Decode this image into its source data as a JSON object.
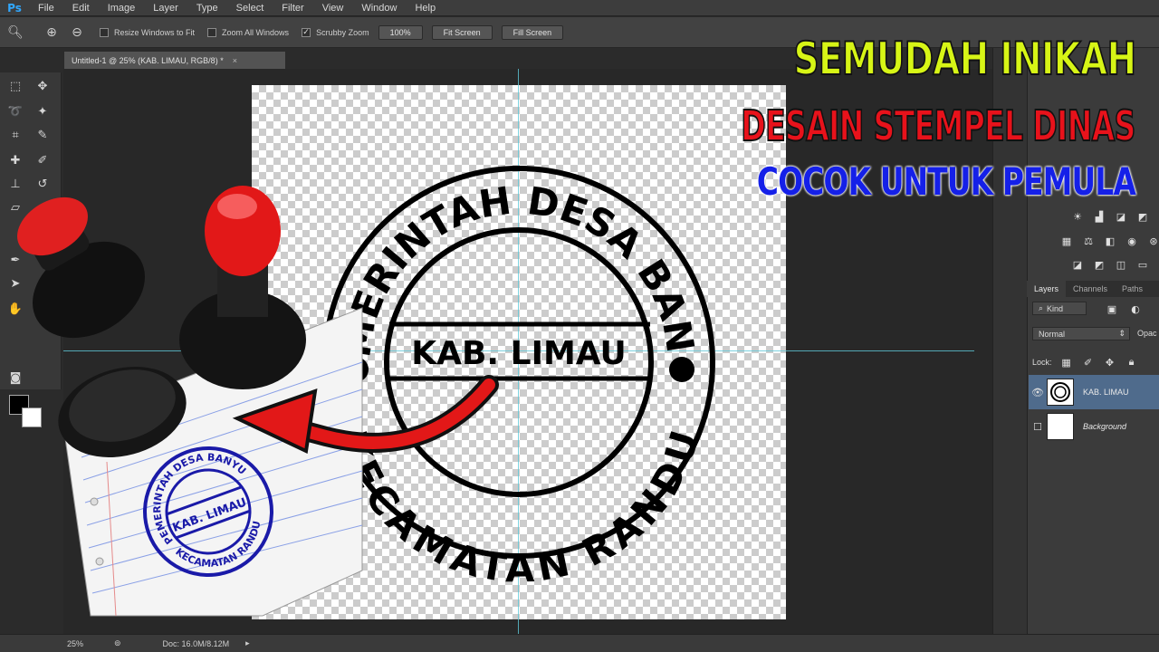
{
  "app": {
    "logo": "Ps"
  },
  "menu": [
    "File",
    "Edit",
    "Image",
    "Layer",
    "Type",
    "Select",
    "Filter",
    "View",
    "Window",
    "Help"
  ],
  "options": {
    "resize_windows": "Resize Windows to Fit",
    "zoom_all": "Zoom All Windows",
    "scrubby_zoom": "Scrubby Zoom",
    "zoom_100": "100%",
    "fit_screen": "Fit Screen",
    "fill_screen": "Fill Screen"
  },
  "document": {
    "tab_title": "Untitled-1 @ 25% (KAB. LIMAU, RGB/8) *",
    "close": "×"
  },
  "status": {
    "zoom": "25%",
    "doc_info": "Doc: 16.0M/8.12M"
  },
  "stamp": {
    "top_arc": "PEMERINTAH DESA BANYU",
    "center": "KAB. LIMAU",
    "bottom_arc": "KECAMATAN RANDU"
  },
  "layers_panel": {
    "tabs": [
      "Layers",
      "Channels",
      "Paths"
    ],
    "kind": "Kind",
    "blend_mode": "Normal",
    "opacity_label": "Opac",
    "lock_label": "Lock:",
    "layers": [
      {
        "name": "KAB. LIMAU",
        "selected": true
      },
      {
        "name": "Background",
        "selected": false
      }
    ]
  },
  "headline": {
    "line1": "SEMUDAH INIKAH",
    "line2": "DESAIN STEMPEL DINAS",
    "line3": "COCOK UNTUK PEMULA"
  },
  "colors": {
    "accent_yellow": "#d7f516",
    "accent_red": "#e8121b",
    "accent_blue": "#1520e8",
    "stamp_ink": "#1a1aa8"
  }
}
